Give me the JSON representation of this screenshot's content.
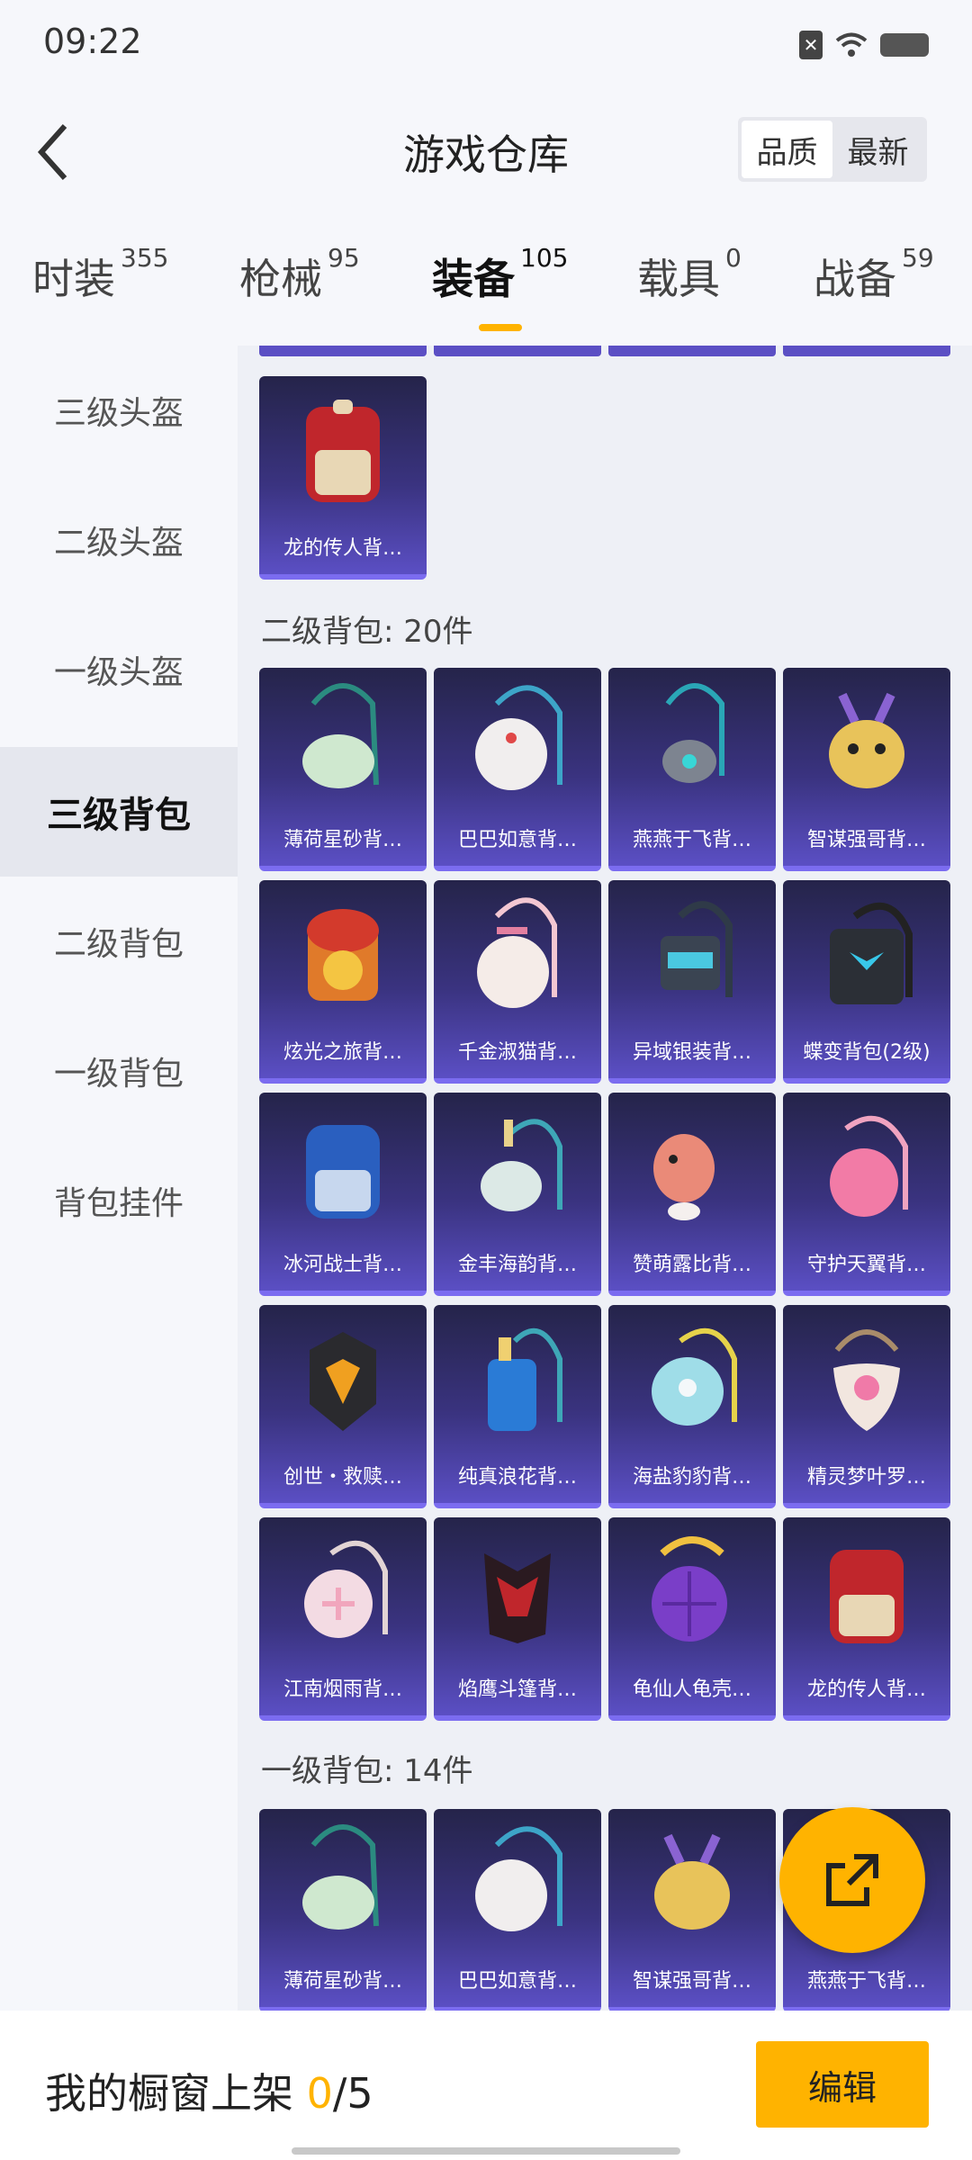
{
  "status": {
    "time": "09:22"
  },
  "header": {
    "title": "游戏仓库",
    "sort_options": [
      "品质",
      "最新"
    ],
    "active_sort": "品质"
  },
  "tabs": [
    {
      "label": "时装",
      "count": "355"
    },
    {
      "label": "枪械",
      "count": "95"
    },
    {
      "label": "装备",
      "count": "105"
    },
    {
      "label": "载具",
      "count": "0"
    },
    {
      "label": "战备",
      "count": "59"
    }
  ],
  "active_tab": "装备",
  "sidebar": {
    "items": [
      "三级头盔",
      "二级头盔",
      "一级头盔",
      "三级背包",
      "二级背包",
      "一级背包",
      "背包挂件"
    ],
    "active": "三级背包"
  },
  "sections": {
    "top_item": "龙的传人背…",
    "level2": {
      "title": "二级背包: 20件",
      "items": [
        "薄荷星砂背…",
        "巴巴如意背…",
        "燕燕于飞背…",
        "智谋强哥背…",
        "炫光之旅背…",
        "千金淑猫背…",
        "异域银装背…",
        "蝶变背包(2级)",
        "冰河战士背…",
        "金丰海韵背…",
        "赞萌露比背…",
        "守护天翼背…",
        "创世・救赎…",
        "纯真浪花背…",
        "海盐豹豹背…",
        "精灵梦叶罗…",
        "江南烟雨背…",
        "焰鹰斗篷背…",
        "龟仙人龟壳…",
        "龙的传人背…"
      ]
    },
    "level1": {
      "title": "一级背包: 14件",
      "items": [
        "薄荷星砂背…",
        "巴巴如意背…",
        "智谋强哥背…",
        "燕燕于飞背…"
      ]
    }
  },
  "bottom": {
    "shelf_prefix": "我的橱窗上架 ",
    "shelf_count": "0",
    "shelf_total": "/5",
    "edit_label": "编辑"
  },
  "colors": {
    "accent": "#ffb300",
    "card_top": "#25244a",
    "card_bottom": "#5b4fc4"
  }
}
